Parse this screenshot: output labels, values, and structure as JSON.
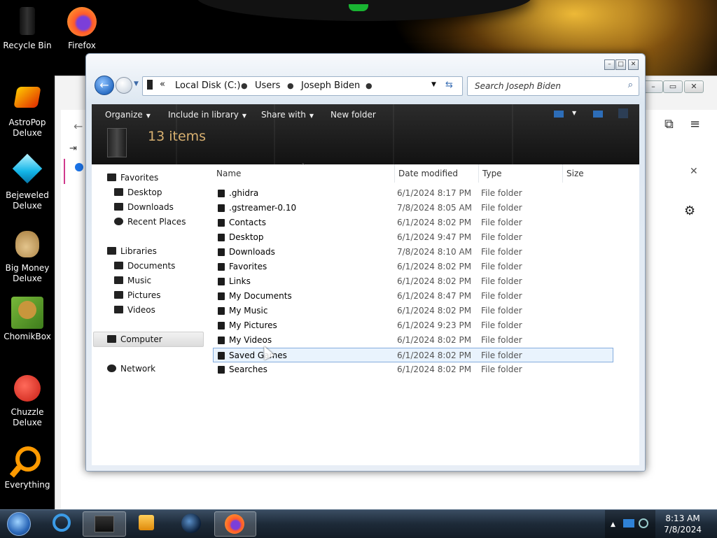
{
  "desktop": {
    "icons": [
      {
        "label": "Recycle Bin",
        "icon": "recycle-bin-icon"
      },
      {
        "label": "Firefox",
        "icon": "firefox-icon"
      },
      {
        "label": "AstroPop Deluxe",
        "icon": "astropop-icon"
      },
      {
        "label": "Bejeweled Deluxe",
        "icon": "bejeweled-icon"
      },
      {
        "label": "Big Money Deluxe",
        "icon": "big-money-icon"
      },
      {
        "label": "ChomikBox",
        "icon": "chomikbox-icon"
      },
      {
        "label": "Chuzzle Deluxe",
        "icon": "chuzzle-icon"
      },
      {
        "label": "Everything",
        "icon": "everything-icon"
      }
    ]
  },
  "explorer": {
    "address": {
      "overflow": "«",
      "crumbs": [
        "Local Disk (C:)",
        "Users",
        "Joseph Biden"
      ]
    },
    "search_placeholder": "Search Joseph Biden",
    "toolbar": {
      "organize": "Organize",
      "include": "Include in library",
      "share": "Share with",
      "new_folder": "New folder"
    },
    "items_count": "13 items",
    "nav": {
      "favorites": "Favorites",
      "desktop": "Desktop",
      "downloads": "Downloads",
      "recent": "Recent Places",
      "libraries": "Libraries",
      "documents": "Documents",
      "music": "Music",
      "pictures": "Pictures",
      "videos": "Videos",
      "computer": "Computer",
      "network": "Network"
    },
    "columns": {
      "name": "Name",
      "date": "Date modified",
      "type": "Type",
      "size": "Size"
    },
    "files": [
      {
        "name": ".ghidra",
        "date": "6/1/2024 8:17 PM",
        "type": "File folder"
      },
      {
        "name": ".gstreamer-0.10",
        "date": "7/8/2024 8:05 AM",
        "type": "File folder"
      },
      {
        "name": "Contacts",
        "date": "6/1/2024 8:02 PM",
        "type": "File folder"
      },
      {
        "name": "Desktop",
        "date": "6/1/2024 9:47 PM",
        "type": "File folder"
      },
      {
        "name": "Downloads",
        "date": "7/8/2024 8:10 AM",
        "type": "File folder"
      },
      {
        "name": "Favorites",
        "date": "6/1/2024 8:02 PM",
        "type": "File folder"
      },
      {
        "name": "Links",
        "date": "6/1/2024 8:02 PM",
        "type": "File folder"
      },
      {
        "name": "My Documents",
        "date": "6/1/2024 8:47 PM",
        "type": "File folder"
      },
      {
        "name": "My Music",
        "date": "6/1/2024 8:02 PM",
        "type": "File folder"
      },
      {
        "name": "My Pictures",
        "date": "6/1/2024 9:23 PM",
        "type": "File folder"
      },
      {
        "name": "My Videos",
        "date": "6/1/2024 8:02 PM",
        "type": "File folder"
      },
      {
        "name": "Saved Games",
        "date": "6/1/2024 8:02 PM",
        "type": "File folder"
      },
      {
        "name": "Searches",
        "date": "6/1/2024 8:02 PM",
        "type": "File folder"
      }
    ]
  },
  "taskbar": {
    "time": "8:13 AM",
    "date": "7/8/2024"
  },
  "colors": {
    "items_count": "#d8b070",
    "selection_border": "#84acdd",
    "selection_fill": "#e9f3fd"
  }
}
